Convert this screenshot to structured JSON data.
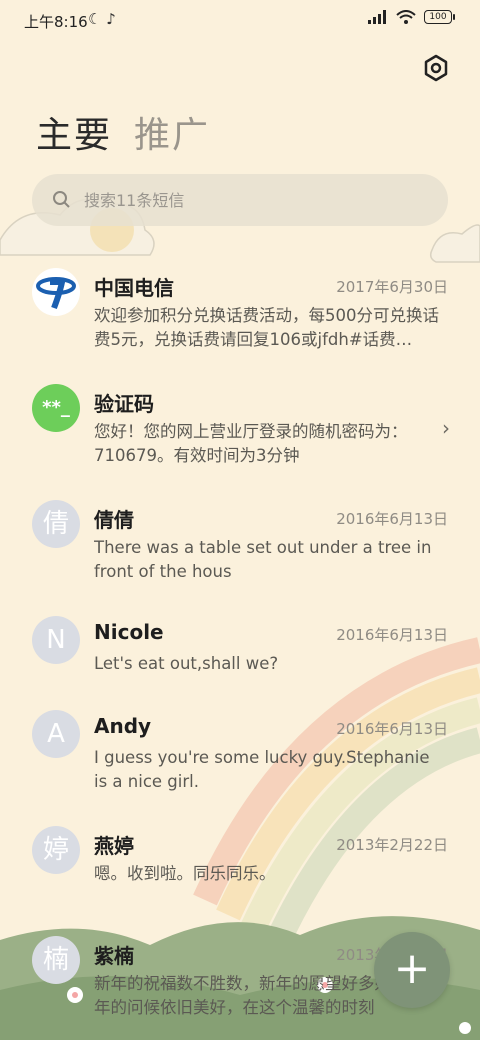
{
  "status_bar": {
    "time": "上午8:16",
    "battery": "100"
  },
  "tabs": [
    {
      "label": "主要",
      "active": true
    },
    {
      "label": "推广",
      "active": false
    }
  ],
  "search": {
    "placeholder": "搜索11条短信"
  },
  "conversations": [
    {
      "name": "中国电信",
      "date": "2017年6月30日",
      "preview": "欢迎参加积分兑换话费活动，每500分可兑换话费5元，兑换话费请回复106或jfdh#话费…",
      "avatar": "china-telecom-logo"
    },
    {
      "name": "验证码",
      "date": "",
      "preview": "您好！您的网上营业厅登录的随机密码为：710679。有效时间为3分钟",
      "avatar_text": "**_"
    },
    {
      "name": "倩倩",
      "date": "2016年6月13日",
      "preview": "There was a table set out under a tree in front of the hous",
      "avatar_text": "倩"
    },
    {
      "name": "Nicole",
      "date": "2016年6月13日",
      "preview": "Let's eat out,shall we?",
      "avatar_text": "N"
    },
    {
      "name": "Andy",
      "date": "2016年6月13日",
      "preview": "I guess you're some lucky guy.Stephanie is a nice girl.",
      "avatar_text": "A"
    },
    {
      "name": "燕婷",
      "date": "2013年2月22日",
      "preview": "嗯。收到啦。同乐同乐。",
      "avatar_text": "婷"
    },
    {
      "name": "紫楠",
      "date": "2013年2月22日",
      "preview": "新年的祝福数不胜数，新年的愿望好多好多，新年的问候依旧美好，在这个温馨的时刻",
      "avatar_text": "楠"
    }
  ],
  "fab": {
    "label": "+"
  },
  "colors": {
    "background": "#fbf1dc",
    "fab": "#7f9378",
    "verify_avatar": "#6dce5a",
    "telecom_blue": "#1b5fb0"
  }
}
